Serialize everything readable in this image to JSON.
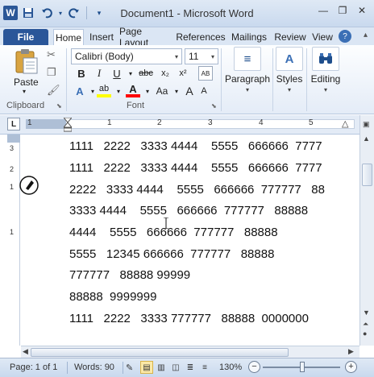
{
  "window": {
    "title": "Document1 - Microsoft Word"
  },
  "qat": {
    "app_icon": "W"
  },
  "tabs": [
    "File",
    "Home",
    "Insert",
    "Page Layout",
    "References",
    "Mailings",
    "Review",
    "View"
  ],
  "ribbon": {
    "clipboard": {
      "label": "Clipboard",
      "paste": "Paste"
    },
    "font": {
      "label": "Font",
      "name": "Calibri (Body)",
      "size": "11",
      "buttons": {
        "bold": "B",
        "italic": "I",
        "underline": "U",
        "strike": "abc",
        "subscript": "x₂",
        "superscript": "x²",
        "effects": "A",
        "highlight": "ab",
        "color": "A",
        "case": "Aa",
        "grow": "A",
        "shrink": "A"
      }
    },
    "paragraph": {
      "label": "Paragraph"
    },
    "styles": {
      "label": "Styles",
      "icon": "A"
    },
    "editing": {
      "label": "Editing"
    }
  },
  "ruler": {
    "tab_selector": "L",
    "h_numbers": [
      "1",
      "1",
      "2",
      "3",
      "4",
      "5"
    ],
    "v_numbers": [
      "3",
      "2",
      "1",
      "1"
    ]
  },
  "document": {
    "lines": [
      "1111   2222   3333 4444    5555   666666  7777",
      "1111   2222   3333 4444    5555   666666  7777",
      "2222   3333 4444    5555   666666  777777   88",
      "3333 4444    5555   666666  777777   88888",
      "4444    5555   666666  777777   88888",
      "5555   12345 666666  777777   88888",
      "777777   88888 99999",
      "88888  9999999",
      "1111   2222   3333 777777   88888  0000000"
    ]
  },
  "status": {
    "page": "Page: 1 of 1",
    "words": "Words: 90",
    "zoom": "130%",
    "zoom_level": 0.61
  },
  "colors": {
    "file_tab": "#2a5699",
    "highlight": "#ffff00",
    "font_color": "#ff0000",
    "accent": "#dbe6f4"
  }
}
